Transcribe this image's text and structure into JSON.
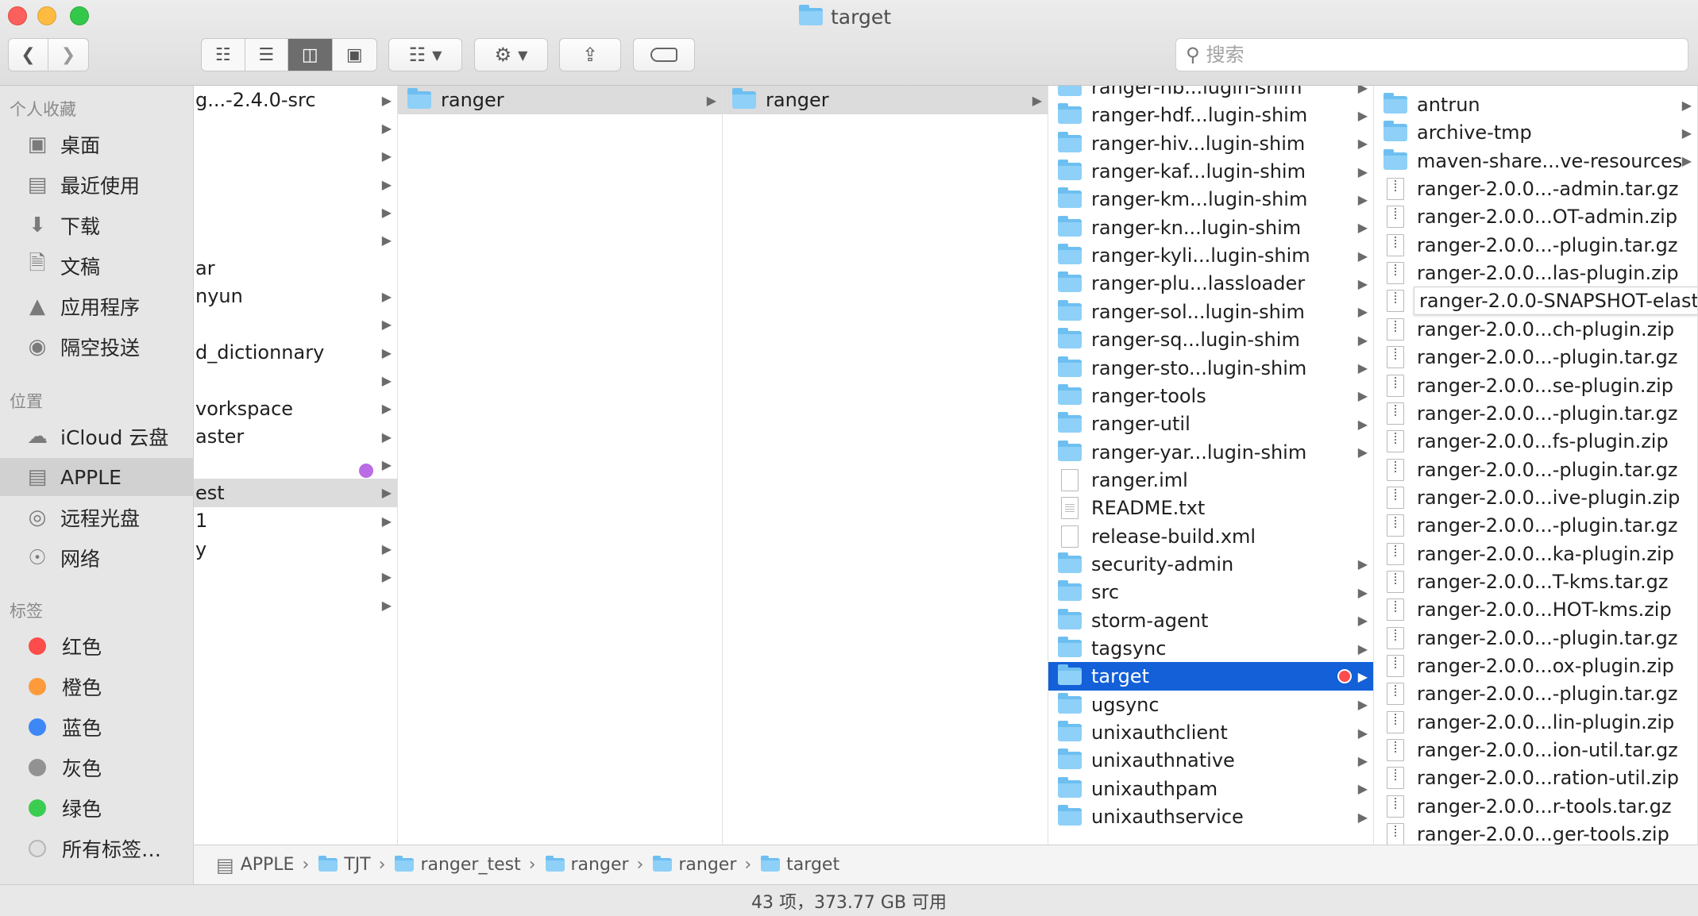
{
  "window": {
    "title": "target"
  },
  "toolbar": {
    "search_placeholder": "搜索",
    "icons": [
      "chevron-left-icon",
      "chevron-right-icon",
      "icon-view-icon",
      "list-view-icon",
      "column-view-icon",
      "gallery-view-icon",
      "group-icon",
      "gear-icon",
      "share-icon",
      "tag-icon"
    ]
  },
  "sidebar": {
    "favorites_header": "个人收藏",
    "favorites": [
      {
        "label": "桌面",
        "icon": "desktop-icon"
      },
      {
        "label": "最近使用",
        "icon": "recents-icon"
      },
      {
        "label": "下载",
        "icon": "download-icon"
      },
      {
        "label": "文稿",
        "icon": "documents-icon"
      },
      {
        "label": "应用程序",
        "icon": "applications-icon"
      },
      {
        "label": "隔空投送",
        "icon": "airdrop-icon"
      }
    ],
    "locations_header": "位置",
    "locations": [
      {
        "label": "iCloud 云盘",
        "icon": "cloud-icon"
      },
      {
        "label": "APPLE",
        "icon": "disk-icon"
      },
      {
        "label": "远程光盘",
        "icon": "disc-icon"
      },
      {
        "label": "网络",
        "icon": "network-icon"
      }
    ],
    "tags_header": "标签",
    "tags": [
      {
        "label": "红色",
        "color": "#fc4c4b"
      },
      {
        "label": "橙色",
        "color": "#fd9b3b"
      },
      {
        "label": "蓝色",
        "color": "#3e87f6"
      },
      {
        "label": "灰色",
        "color": "#929292"
      },
      {
        "label": "绿色",
        "color": "#3bcd50"
      },
      {
        "label": "所有标签…",
        "color": "#e0e0e0"
      }
    ]
  },
  "col1": [
    {
      "name": "g...-2.4.0-src",
      "arrow": true
    },
    {
      "name": "",
      "arrow": true
    },
    {
      "name": "",
      "arrow": true
    },
    {
      "name": "",
      "arrow": true
    },
    {
      "name": "",
      "arrow": true
    },
    {
      "name": "",
      "arrow": true
    },
    {
      "name": "ar",
      "arrow": false
    },
    {
      "name": "nyun",
      "arrow": true
    },
    {
      "name": "",
      "arrow": true
    },
    {
      "name": "d_dictionnary",
      "arrow": true
    },
    {
      "name": "",
      "arrow": true
    },
    {
      "name": "vorkspace",
      "arrow": true
    },
    {
      "name": "aster",
      "arrow": true
    },
    {
      "name": "",
      "arrow": true
    },
    {
      "name": "est",
      "arrow": true
    },
    {
      "name": "1",
      "arrow": true
    },
    {
      "name": "y",
      "arrow": true
    },
    {
      "name": "",
      "arrow": true
    },
    {
      "name": "",
      "arrow": true
    }
  ],
  "col2": [
    {
      "name": "ranger"
    }
  ],
  "col3": [
    {
      "name": "ranger"
    }
  ],
  "col4": [
    {
      "name": "ranger-hb...lugin-shim",
      "kind": "folder"
    },
    {
      "name": "ranger-hdf...lugin-shim",
      "kind": "folder"
    },
    {
      "name": "ranger-hiv...lugin-shim",
      "kind": "folder"
    },
    {
      "name": "ranger-kaf...lugin-shim",
      "kind": "folder"
    },
    {
      "name": "ranger-km...lugin-shim",
      "kind": "folder"
    },
    {
      "name": "ranger-kn...lugin-shim",
      "kind": "folder"
    },
    {
      "name": "ranger-kyli...lugin-shim",
      "kind": "folder"
    },
    {
      "name": "ranger-plu...lassloader",
      "kind": "folder"
    },
    {
      "name": "ranger-sol...lugin-shim",
      "kind": "folder"
    },
    {
      "name": "ranger-sq...lugin-shim",
      "kind": "folder"
    },
    {
      "name": "ranger-sto...lugin-shim",
      "kind": "folder"
    },
    {
      "name": "ranger-tools",
      "kind": "folder"
    },
    {
      "name": "ranger-util",
      "kind": "folder"
    },
    {
      "name": "ranger-yar...lugin-shim",
      "kind": "folder"
    },
    {
      "name": "ranger.iml",
      "kind": "file"
    },
    {
      "name": "README.txt",
      "kind": "txt"
    },
    {
      "name": "release-build.xml",
      "kind": "file"
    },
    {
      "name": "security-admin",
      "kind": "folder"
    },
    {
      "name": "src",
      "kind": "folder"
    },
    {
      "name": "storm-agent",
      "kind": "folder"
    },
    {
      "name": "tagsync",
      "kind": "folder"
    },
    {
      "name": "target",
      "kind": "folder",
      "active": true,
      "tag": "#fc4c4b"
    },
    {
      "name": "ugsync",
      "kind": "folder"
    },
    {
      "name": "unixauthclient",
      "kind": "folder"
    },
    {
      "name": "unixauthnative",
      "kind": "folder"
    },
    {
      "name": "unixauthpam",
      "kind": "folder"
    },
    {
      "name": "unixauthservice",
      "kind": "folder"
    }
  ],
  "col5": [
    {
      "name": "antrun",
      "kind": "folder"
    },
    {
      "name": "archive-tmp",
      "kind": "folder"
    },
    {
      "name": "maven-share...ve-resources",
      "kind": "folder"
    },
    {
      "name": "ranger-2.0.0...-admin.tar.gz",
      "kind": "zip"
    },
    {
      "name": "ranger-2.0.0...OT-admin.zip",
      "kind": "zip"
    },
    {
      "name": "ranger-2.0.0...-plugin.tar.gz",
      "kind": "zip"
    },
    {
      "name": "ranger-2.0.0...las-plugin.zip",
      "kind": "zip"
    },
    {
      "name": "ranger-2.0.0-SNAPSHOT-elast",
      "kind": "zip",
      "tooltip": true
    },
    {
      "name": "ranger-2.0.0...ch-plugin.zip",
      "kind": "zip"
    },
    {
      "name": "ranger-2.0.0...-plugin.tar.gz",
      "kind": "zip"
    },
    {
      "name": "ranger-2.0.0...se-plugin.zip",
      "kind": "zip"
    },
    {
      "name": "ranger-2.0.0...-plugin.tar.gz",
      "kind": "zip"
    },
    {
      "name": "ranger-2.0.0...fs-plugin.zip",
      "kind": "zip"
    },
    {
      "name": "ranger-2.0.0...-plugin.tar.gz",
      "kind": "zip"
    },
    {
      "name": "ranger-2.0.0...ive-plugin.zip",
      "kind": "zip"
    },
    {
      "name": "ranger-2.0.0...-plugin.tar.gz",
      "kind": "zip"
    },
    {
      "name": "ranger-2.0.0...ka-plugin.zip",
      "kind": "zip"
    },
    {
      "name": "ranger-2.0.0...T-kms.tar.gz",
      "kind": "zip"
    },
    {
      "name": "ranger-2.0.0...HOT-kms.zip",
      "kind": "zip"
    },
    {
      "name": "ranger-2.0.0...-plugin.tar.gz",
      "kind": "zip"
    },
    {
      "name": "ranger-2.0.0...ox-plugin.zip",
      "kind": "zip"
    },
    {
      "name": "ranger-2.0.0...-plugin.tar.gz",
      "kind": "zip"
    },
    {
      "name": "ranger-2.0.0...lin-plugin.zip",
      "kind": "zip"
    },
    {
      "name": "ranger-2.0.0...ion-util.tar.gz",
      "kind": "zip"
    },
    {
      "name": "ranger-2.0.0...ration-util.zip",
      "kind": "zip"
    },
    {
      "name": "ranger-2.0.0...r-tools.tar.gz",
      "kind": "zip"
    },
    {
      "name": "ranger-2.0.0...ger-tools.zip",
      "kind": "zip"
    }
  ],
  "pathbar": [
    {
      "label": "APPLE",
      "icon": "disk-icon"
    },
    {
      "label": "TJT",
      "icon": "folder-icon"
    },
    {
      "label": "ranger_test",
      "icon": "folder-icon"
    },
    {
      "label": "ranger",
      "icon": "folder-icon"
    },
    {
      "label": "ranger",
      "icon": "folder-icon"
    },
    {
      "label": "target",
      "icon": "folder-icon"
    }
  ],
  "status": {
    "text": "43 项，373.77 GB 可用"
  }
}
